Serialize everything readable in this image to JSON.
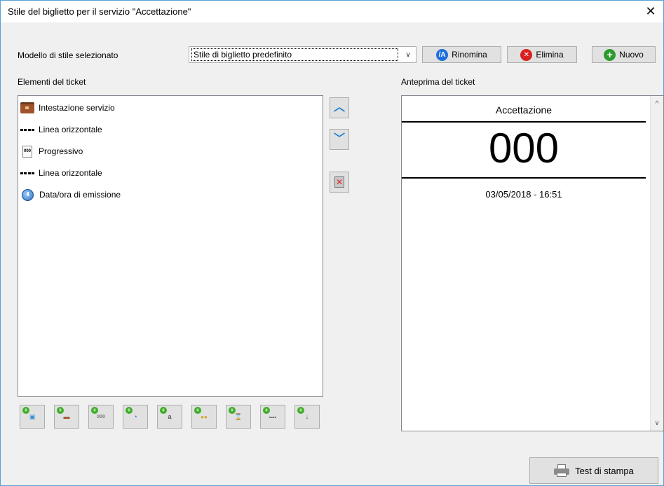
{
  "window": {
    "title": "Stile del biglietto per il servizio \"Accettazione\"",
    "close_glyph": "✕"
  },
  "style_model": {
    "label": "Modello di stile selezionato",
    "selected": "Stile di biglietto predefinito",
    "arrow_glyph": "∨"
  },
  "toolbar": {
    "rename": {
      "label": "Rinomina",
      "icon": "rename-icon",
      "icon_glyph": "/A",
      "color": "#1e6fd9"
    },
    "delete": {
      "label": "Elimina",
      "icon": "delete-icon",
      "icon_glyph": "✕",
      "color": "#d92020"
    },
    "new": {
      "label": "Nuovo",
      "icon": "add-icon",
      "icon_glyph": "+",
      "color": "#2e9a2e"
    }
  },
  "elements_panel": {
    "label": "Elementi del ticket",
    "items": [
      {
        "label": "Intestazione servizio",
        "icon": "briefcase-icon"
      },
      {
        "label": "Linea orizzontale",
        "icon": "dashed-line-icon"
      },
      {
        "label": "Progressivo",
        "icon": "ticket-number-icon"
      },
      {
        "label": "Linea orizzontale",
        "icon": "dashed-line-icon"
      },
      {
        "label": "Data/ora di emissione",
        "icon": "clock-icon"
      }
    ]
  },
  "side_buttons": {
    "up_glyph": "︿",
    "down_glyph": "﹀",
    "remove_glyph": "✕"
  },
  "add_buttons": [
    {
      "icon": "add-image-icon",
      "glyph": "▣",
      "color": "#3a8fd0"
    },
    {
      "icon": "add-service-header-icon",
      "glyph": "▬",
      "color": "#a0522d"
    },
    {
      "icon": "add-progressive-icon",
      "glyph": "000",
      "color": "#777777"
    },
    {
      "icon": "add-datetime-icon",
      "glyph": "◔",
      "color": "#2a6fc0"
    },
    {
      "icon": "add-text-icon",
      "glyph": "a",
      "color": "#555555"
    },
    {
      "icon": "add-people-icon",
      "glyph": "●●",
      "color": "#d9a21e"
    },
    {
      "icon": "add-wait-time-icon",
      "glyph": "⌛",
      "color": "#6a8aa8"
    },
    {
      "icon": "add-horizontal-line-icon",
      "glyph": "----",
      "color": "#000000"
    },
    {
      "icon": "add-page-break-icon",
      "glyph": "↓",
      "color": "#555555"
    }
  ],
  "preview": {
    "label": "Anteprima del ticket",
    "service": "Accettazione",
    "number": "000",
    "datetime": "03/05/2018 - 16:51",
    "scroll_up_glyph": "^",
    "scroll_down_glyph": "∨"
  },
  "print_test": {
    "label": "Test di stampa",
    "icon": "printer-icon"
  }
}
